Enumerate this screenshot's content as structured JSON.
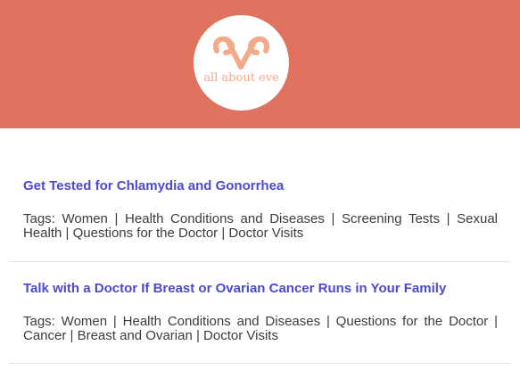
{
  "header": {
    "logo_text": "all about eve",
    "background_color": "#e07260",
    "logo_accent_color": "#f3a98a",
    "logo_icon": "ram-horns-icon"
  },
  "articles": [
    {
      "title": "Get Tested for Chlamydia and Gonorrhea",
      "tags_line": "Tags: Women | Health Conditions and Diseases | Screening Tests | Sexual Health | Questions for the Doctor | Doctor Visits"
    },
    {
      "title": "Talk with a Doctor If Breast or Ovarian Cancer Runs in Your Family",
      "tags_line": "Tags: Women | Health Conditions and Diseases | Questions for the Doctor | Cancer | Breast and Ovarian | Doctor Visits"
    }
  ],
  "colors": {
    "link": "#4b4ad0",
    "text": "#3c3c3c"
  }
}
